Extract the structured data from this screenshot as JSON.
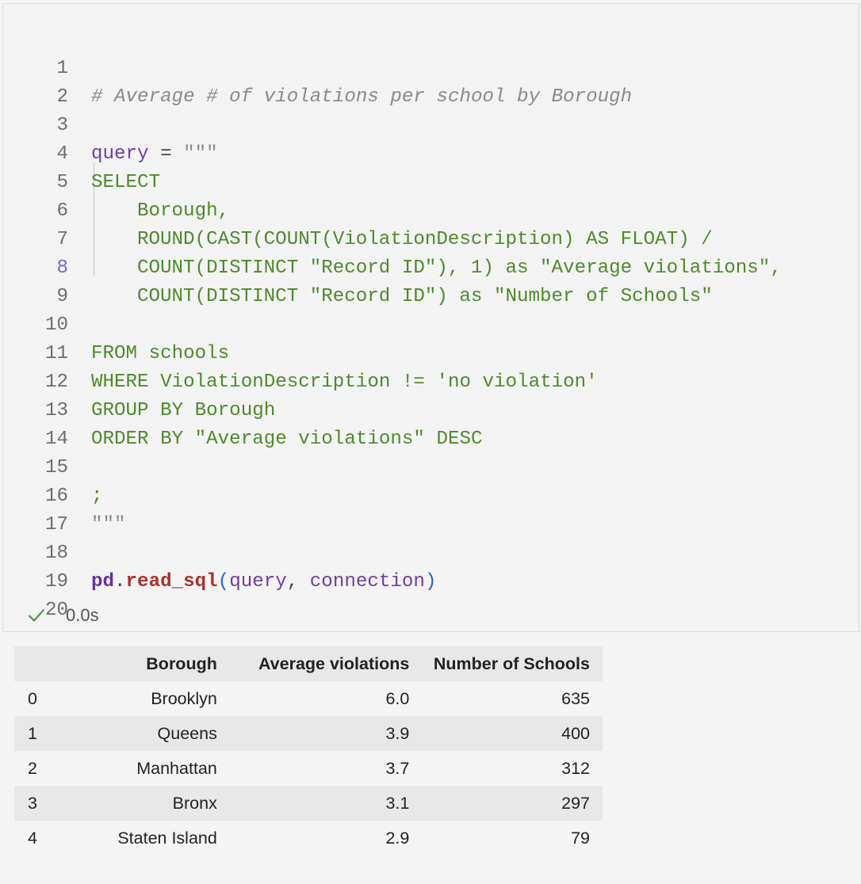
{
  "code": {
    "line_numbers": [
      "1",
      "2",
      "3",
      "4",
      "5",
      "6",
      "7",
      "8",
      "9",
      "10",
      "11",
      "12",
      "13",
      "14",
      "15",
      "16",
      "17",
      "18",
      "19",
      "20"
    ],
    "l1_comment": "# Average # of violations per school by Borough",
    "l3_var": "query",
    "l3_op": " = ",
    "l3_quote": "\"\"\"",
    "l4": "SELECT",
    "l5": "Borough,",
    "l6": "ROUND(CAST(COUNT(ViolationDescription) AS FLOAT) /",
    "l7": "COUNT(DISTINCT \"Record ID\"), 1) as \"Average violations\",",
    "l8": "COUNT(DISTINCT \"Record ID\") as \"Number of Schools\"",
    "l10": "FROM schools",
    "l11": "WHERE ViolationDescription != 'no violation'",
    "l12": "GROUP BY Borough",
    "l13": "ORDER BY \"Average violations\" DESC",
    "l15": ";",
    "l16": "\"\"\"",
    "l18_mod": "pd",
    "l18_dot": ".",
    "l18_fn": "read_sql",
    "l18_open": "(",
    "l18_arg1": "query",
    "l18_comma": ", ",
    "l18_arg2": "connection",
    "l18_close": ")"
  },
  "status": {
    "icon": "check-icon",
    "time": "0.0s"
  },
  "table": {
    "index_header": "",
    "columns": [
      "Borough",
      "Average violations",
      "Number of Schools"
    ],
    "rows": [
      {
        "index": "0",
        "borough": "Brooklyn",
        "avg": "6.0",
        "count": "635"
      },
      {
        "index": "1",
        "borough": "Queens",
        "avg": "3.9",
        "count": "400"
      },
      {
        "index": "2",
        "borough": "Manhattan",
        "avg": "3.7",
        "count": "312"
      },
      {
        "index": "3",
        "borough": "Bronx",
        "avg": "3.1",
        "count": "297"
      },
      {
        "index": "4",
        "borough": "Staten Island",
        "avg": "2.9",
        "count": "79"
      }
    ]
  },
  "colors": {
    "keyword_green": "#4e8a2c",
    "variable_purple": "#6f3fa0",
    "function_red": "#a8322b",
    "paren_blue": "#2563d9",
    "check_green": "#3d8f3d"
  }
}
